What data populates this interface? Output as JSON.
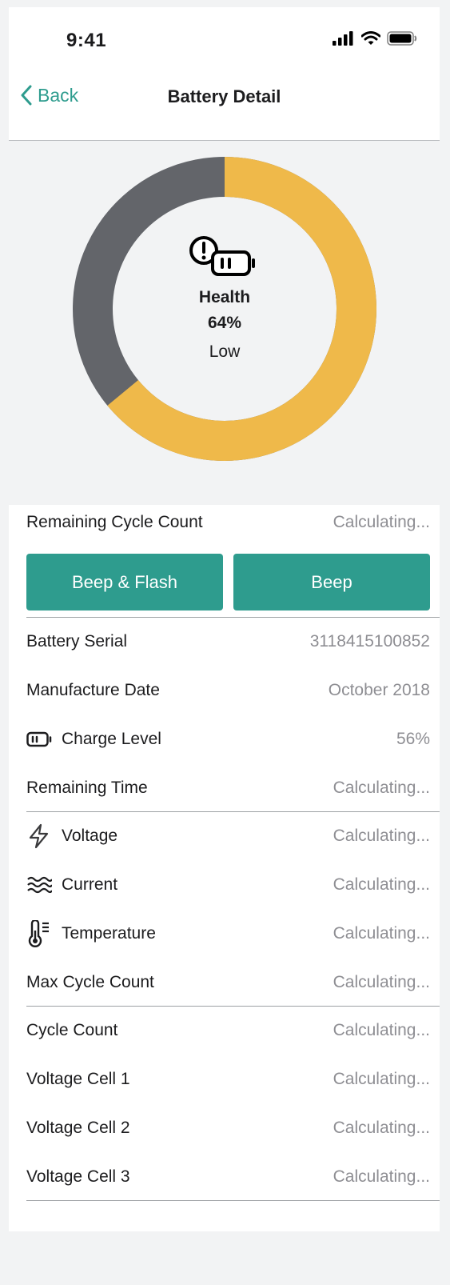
{
  "status_bar": {
    "time": "9:41"
  },
  "nav": {
    "back_label": "Back",
    "title": "Battery Detail"
  },
  "health": {
    "label": "Health",
    "value": "64%",
    "status": "Low",
    "percent": 64,
    "colors": {
      "filled": "#efb94a",
      "remaining": "#63656a"
    },
    "icon": "battery-alert-icon"
  },
  "remaining_cycle": {
    "label": "Remaining Cycle Count",
    "value": "Calculating..."
  },
  "buttons": {
    "beep_flash": "Beep & Flash",
    "beep": "Beep"
  },
  "details": {
    "serial": {
      "label": "Battery Serial",
      "value": "3118415100852"
    },
    "manufacture": {
      "label": "Manufacture Date",
      "value": "October 2018"
    },
    "charge": {
      "label": "Charge Level",
      "value": "56%",
      "icon": "battery-icon"
    },
    "remaining_time": {
      "label": "Remaining Time",
      "value": "Calculating..."
    }
  },
  "electrical": {
    "voltage": {
      "label": "Voltage",
      "value": "Calculating...",
      "icon": "lightning-icon"
    },
    "current": {
      "label": "Current",
      "value": "Calculating...",
      "icon": "waves-icon"
    },
    "temperature": {
      "label": "Temperature",
      "value": "Calculating...",
      "icon": "thermometer-icon"
    },
    "max_cycle": {
      "label": "Max Cycle Count",
      "value": "Calculating..."
    }
  },
  "cells": {
    "cycle_count": {
      "label": "Cycle Count",
      "value": "Calculating..."
    },
    "cell1": {
      "label": "Voltage Cell 1",
      "value": "Calculating..."
    },
    "cell2": {
      "label": "Voltage Cell 2",
      "value": "Calculating..."
    },
    "cell3": {
      "label": "Voltage Cell 3",
      "value": "Calculating..."
    }
  },
  "colors": {
    "accent": "#2e9c8e",
    "value_text": "#8e8e93",
    "background": "#f2f3f4"
  }
}
